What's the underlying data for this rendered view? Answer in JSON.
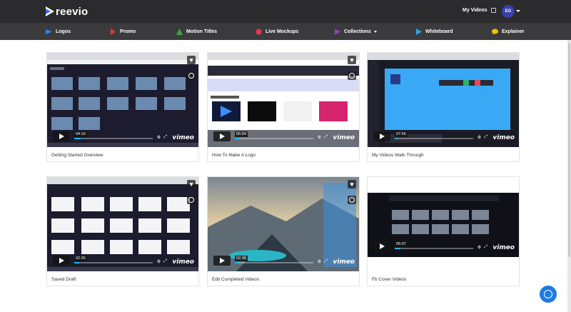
{
  "app": {
    "logo_text": "reevio"
  },
  "header": {
    "my_videos_label": "My Videos",
    "avatar_initials": "EG"
  },
  "nav": {
    "items": [
      {
        "label": "Logos",
        "icon": "logo-icon",
        "color": "#2d7ff9"
      },
      {
        "label": "Promo",
        "icon": "promo-icon",
        "color": "#e53935"
      },
      {
        "label": "Motion Titles",
        "icon": "motion-titles-icon",
        "color": "#43a047"
      },
      {
        "label": "Live Mockups",
        "icon": "live-mockups-icon",
        "color": "#e53950"
      },
      {
        "label": "Collections",
        "icon": "collections-icon",
        "color": "#8e44ad"
      },
      {
        "label": "Whiteboard",
        "icon": "whiteboard-icon",
        "color": "#29a7e1"
      },
      {
        "label": "Explainer",
        "icon": "explainer-icon",
        "color": "#f4c20d"
      }
    ]
  },
  "videos": [
    {
      "title": "Getting Started Overview",
      "timecode": "04:16",
      "progress": 0.08
    },
    {
      "title": "How To Make A Logo",
      "timecode": "05:04",
      "progress": 0.05
    },
    {
      "title": "My Videos Walk-Through",
      "timecode": "07:56",
      "progress": 0.04
    },
    {
      "title": "Saved Draft",
      "timecode": "02:35",
      "progress": 0.06
    },
    {
      "title": "Edit Completed Videos",
      "timecode": "02:38",
      "progress": 0.05
    },
    {
      "title": "Fb Cover Videos",
      "timecode": "05:07",
      "progress": 0.07
    }
  ],
  "player": {
    "brand": "vimeo"
  },
  "colors": {
    "accent": "#1ab7ea",
    "topbar": "#2b2b2d",
    "navbar": "#3b3b3e",
    "chat": "#1e7be0"
  }
}
